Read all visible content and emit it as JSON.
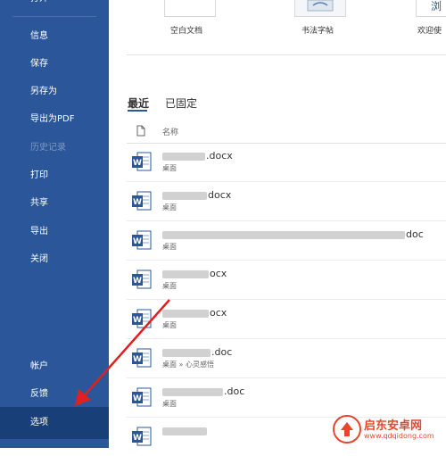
{
  "sidebar": {
    "top_label": "打开",
    "items": [
      {
        "label": "信息"
      },
      {
        "label": "保存"
      },
      {
        "label": "另存为"
      },
      {
        "label": "导出为PDF"
      },
      {
        "label": "历史记录"
      },
      {
        "label": "打印"
      },
      {
        "label": "共享"
      },
      {
        "label": "导出"
      },
      {
        "label": "关闭"
      }
    ],
    "bottom_items": [
      {
        "label": "帐户"
      },
      {
        "label": "反馈"
      },
      {
        "label": "选项"
      }
    ]
  },
  "templates": [
    {
      "label": "空白文档"
    },
    {
      "label": "书法字帖"
    },
    {
      "label": "欢迎使",
      "thumb_text": "浏"
    }
  ],
  "tabs": [
    {
      "label": "最近"
    },
    {
      "label": "已固定"
    }
  ],
  "column_header": "名称",
  "files": [
    {
      "name_suffix": ".docx",
      "path": "桌面"
    },
    {
      "name_suffix": "docx",
      "path": "桌面"
    },
    {
      "name_suffix": "doc",
      "path": "桌面"
    },
    {
      "name_suffix": "ocx",
      "path": "桌面"
    },
    {
      "name_suffix": "ocx",
      "path": "桌面"
    },
    {
      "name_suffix": ".doc",
      "path": "桌面 » 心灵感悟"
    },
    {
      "name_suffix": ".doc",
      "path": "桌面"
    },
    {
      "name_suffix": "",
      "path": ""
    }
  ],
  "watermark": {
    "title": "启东安卓网",
    "url": "www.qdqidong.com"
  },
  "colors": {
    "sidebar_bg": "#2b579a",
    "sidebar_selected": "#193f79",
    "word_blue": "#2b579a",
    "arrow_red": "#e02020"
  }
}
